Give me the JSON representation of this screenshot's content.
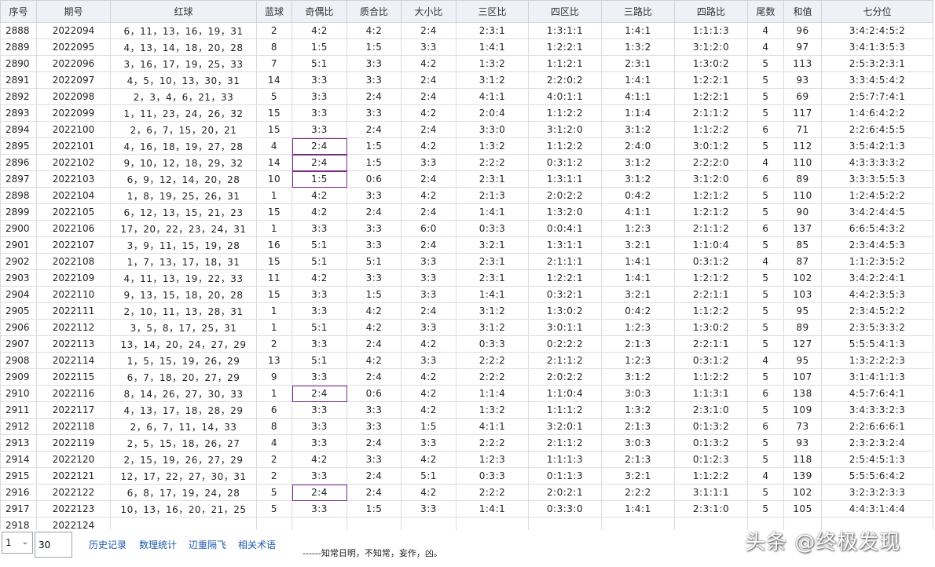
{
  "columns": [
    "序号",
    "期号",
    "红球",
    "蓝球",
    "奇偶比",
    "质合比",
    "大小比",
    "三区比",
    "四区比",
    "三路比",
    "四路比",
    "尾数",
    "和值",
    "七分位"
  ],
  "rows": [
    [
      "2888",
      "2022094",
      "6，11，13，16，19，31",
      "2",
      "4:2",
      "4:2",
      "2:4",
      "2:3:1",
      "1:3:1:1",
      "1:4:1",
      "1:1:1:3",
      "4",
      "96",
      "3:4:2:4:5:2"
    ],
    [
      "2889",
      "2022095",
      "4，13，14，18，20，28",
      "8",
      "1:5",
      "1:5",
      "3:3",
      "1:4:1",
      "1:2:2:1",
      "1:3:2",
      "3:1:2:0",
      "4",
      "97",
      "3:4:1:3:5:3"
    ],
    [
      "2890",
      "2022096",
      "3，16，17，19，25，33",
      "7",
      "5:1",
      "3:3",
      "4:2",
      "1:3:2",
      "1:1:2:1",
      "2:3:1",
      "1:3:0:2",
      "5",
      "113",
      "2:5:3:2:3:1"
    ],
    [
      "2891",
      "2022097",
      "4，5，10，13，30，31",
      "14",
      "3:3",
      "3:3",
      "2:4",
      "3:1:2",
      "2:2:0:2",
      "1:4:1",
      "1:2:2:1",
      "5",
      "93",
      "3:3:4:5:4:2"
    ],
    [
      "2892",
      "2022098",
      "2，3，4，6，21，33",
      "5",
      "3:3",
      "2:4",
      "2:4",
      "4:1:1",
      "4:0:1:1",
      "4:1:1",
      "1:2:2:1",
      "5",
      "69",
      "2:5:7:7:4:1"
    ],
    [
      "2893",
      "2022099",
      "1，11，23，24，26，32",
      "15",
      "3:3",
      "3:3",
      "4:2",
      "2:0:4",
      "1:1:2:2",
      "1:1:4",
      "2:1:1:2",
      "5",
      "117",
      "1:4:6:4:2:2"
    ],
    [
      "2894",
      "2022100",
      "2，6，7，15，20，21",
      "15",
      "3:3",
      "2:4",
      "2:4",
      "3:3:0",
      "3:1:2:0",
      "3:1:2",
      "1:1:2:2",
      "6",
      "71",
      "2:2:6:4:5:5"
    ],
    [
      "2895",
      "2022101",
      "4，16，18，19，27，28",
      "4",
      "2:4",
      "1:5",
      "4:2",
      "1:3:2",
      "1:1:2:2",
      "2:4:0",
      "3:0:1:2",
      "5",
      "112",
      "3:5:4:2:1:3"
    ],
    [
      "2896",
      "2022102",
      "9，10，12，18，29，32",
      "14",
      "2:4",
      "1:5",
      "3:3",
      "2:2:2",
      "0:3:1:2",
      "3:1:2",
      "2:2:2:0",
      "4",
      "110",
      "4:3:3:3:3:2"
    ],
    [
      "2897",
      "2022103",
      "6，9，12，14，20，28",
      "10",
      "1:5",
      "0:6",
      "2:4",
      "2:3:1",
      "1:3:1:1",
      "3:1:2",
      "3:1:2:0",
      "6",
      "89",
      "3:3:3:5:5:3"
    ],
    [
      "2898",
      "2022104",
      "1，8，19，25，26，31",
      "1",
      "4:2",
      "3:3",
      "4:2",
      "2:1:3",
      "2:0:2:2",
      "0:4:2",
      "1:2:1:2",
      "5",
      "110",
      "1:2:4:5:2:2"
    ],
    [
      "2899",
      "2022105",
      "6，12，13，15，21，23",
      "15",
      "4:2",
      "2:4",
      "2:4",
      "1:4:1",
      "1:3:2:0",
      "4:1:1",
      "1:2:1:2",
      "5",
      "90",
      "3:4:2:4:4:5"
    ],
    [
      "2900",
      "2022106",
      "17，20，22，23，24，31",
      "1",
      "3:3",
      "3:3",
      "6:0",
      "0:3:3",
      "0:0:4:1",
      "1:2:3",
      "2:1:1:2",
      "6",
      "137",
      "6:6:5:4:3:2"
    ],
    [
      "2901",
      "2022107",
      "3，9，11，15，19，28",
      "16",
      "5:1",
      "3:3",
      "2:4",
      "3:2:1",
      "1:3:1:1",
      "3:2:1",
      "1:1:0:4",
      "5",
      "85",
      "2:3:4:4:5:3"
    ],
    [
      "2902",
      "2022108",
      "1，7，13，17，18，31",
      "15",
      "5:1",
      "5:1",
      "3:3",
      "2:3:1",
      "2:1:1:1",
      "1:4:1",
      "0:3:1:2",
      "4",
      "87",
      "1:1:2:3:5:2"
    ],
    [
      "2903",
      "2022109",
      "4，11，13，19，22，33",
      "11",
      "4:2",
      "3:3",
      "3:3",
      "2:3:1",
      "1:2:2:1",
      "1:4:1",
      "1:2:1:2",
      "5",
      "102",
      "3:4:2:2:4:1"
    ],
    [
      "2904",
      "2022110",
      "9，13，15，18，20，28",
      "15",
      "3:3",
      "1:5",
      "3:3",
      "1:4:1",
      "0:3:2:1",
      "3:2:1",
      "2:2:1:1",
      "5",
      "103",
      "4:4:2:3:5:3"
    ],
    [
      "2905",
      "2022111",
      "2，10，11，13，28，31",
      "1",
      "3:3",
      "4:2",
      "2:4",
      "3:1:2",
      "1:3:0:2",
      "0:4:2",
      "1:1:2:2",
      "5",
      "95",
      "2:3:4:5:2:2"
    ],
    [
      "2906",
      "2022112",
      "3，5，8，17，25，31",
      "1",
      "5:1",
      "4:2",
      "3:3",
      "3:1:2",
      "3:0:1:1",
      "1:2:3",
      "1:3:0:2",
      "5",
      "89",
      "2:3:5:3:3:2"
    ],
    [
      "2907",
      "2022113",
      "13，14，20，24，27，29",
      "2",
      "3:3",
      "2:4",
      "4:2",
      "0:3:3",
      "0:2:2:2",
      "2:1:3",
      "2:2:1:1",
      "5",
      "127",
      "5:5:5:4:1:3"
    ],
    [
      "2908",
      "2022114",
      "1，5，15，19，26，29",
      "13",
      "5:1",
      "4:2",
      "3:3",
      "2:2:2",
      "2:1:1:2",
      "1:2:3",
      "0:3:1:2",
      "4",
      "95",
      "1:3:2:2:2:3"
    ],
    [
      "2909",
      "2022115",
      "6，7，18，20，27，29",
      "9",
      "3:3",
      "2:4",
      "4:2",
      "2:2:2",
      "2:0:2:2",
      "3:1:2",
      "1:1:2:2",
      "5",
      "107",
      "3:1:4:1:1:3"
    ],
    [
      "2910",
      "2022116",
      "8，14，26，27，30，33",
      "1",
      "2:4",
      "0:6",
      "4:2",
      "1:1:4",
      "1:1:0:4",
      "3:0:3",
      "1:1:3:1",
      "6",
      "138",
      "4:5:7:6:4:1"
    ],
    [
      "2911",
      "2022117",
      "4，13，17，18，28，29",
      "6",
      "3:3",
      "3:3",
      "4:2",
      "1:3:2",
      "1:1:1:2",
      "1:3:2",
      "2:3:1:0",
      "5",
      "109",
      "3:4:3:3:2:3"
    ],
    [
      "2912",
      "2022118",
      "2，6，7，11，14，33",
      "8",
      "3:3",
      "3:3",
      "1:5",
      "4:1:1",
      "3:2:0:1",
      "2:1:3",
      "0:1:3:2",
      "6",
      "73",
      "2:2:6:6:6:1"
    ],
    [
      "2913",
      "2022119",
      "2，5，15，18，26，27",
      "4",
      "3:3",
      "2:4",
      "3:3",
      "2:2:2",
      "2:1:1:2",
      "3:0:3",
      "0:1:3:2",
      "5",
      "93",
      "2:3:2:3:2:4"
    ],
    [
      "2914",
      "2022120",
      "2，15，19，26，27，29",
      "2",
      "4:2",
      "3:3",
      "4:2",
      "1:2:3",
      "1:1:1:3",
      "2:1:3",
      "0:1:2:3",
      "5",
      "118",
      "2:5:4:5:1:3"
    ],
    [
      "2915",
      "2022121",
      "12，17，22，27，30，31",
      "2",
      "3:3",
      "2:4",
      "5:1",
      "0:3:3",
      "0:1:1:3",
      "3:2:1",
      "1:1:2:2",
      "4",
      "139",
      "5:5:5:6:4:2"
    ],
    [
      "2916",
      "2022122",
      "6，8，17，19，24，28",
      "5",
      "2:4",
      "2:4",
      "4:2",
      "2:2:2",
      "2:0:2:1",
      "2:2:2",
      "3:1:1:1",
      "5",
      "102",
      "3:2:3:2:3:3"
    ],
    [
      "2917",
      "2022123",
      "10，13，16，20，21，25",
      "5",
      "3:3",
      "1:5",
      "3:3",
      "1:4:1",
      "0:3:3:0",
      "1:4:1",
      "2:3:1:0",
      "5",
      "105",
      "4:4:3:1:4:4"
    ],
    [
      "2918",
      "2022124",
      "",
      "",
      "",
      "",
      "",
      "",
      "",
      "",
      "",
      "",
      "",
      ""
    ]
  ],
  "highlighted_cells": [
    {
      "row": 7,
      "col": 4
    },
    {
      "row": 8,
      "col": 4
    },
    {
      "row": 9,
      "col": 4
    },
    {
      "row": 22,
      "col": 4
    },
    {
      "row": 28,
      "col": 4
    }
  ],
  "footer": {
    "page_select_value": "1",
    "page_size_value": "30",
    "links": [
      "历史记录",
      "数理统计",
      "辺重隔飞",
      "相关术语"
    ],
    "motto": "------知常日明，不知常，妄作，凶。"
  },
  "watermark": "头条 @终极发现",
  "colors": {
    "header_bg": "#eef1f5",
    "grid_line": "#d9dde2",
    "highlight_border": "#7a2b84",
    "link": "#1f5aa8"
  }
}
